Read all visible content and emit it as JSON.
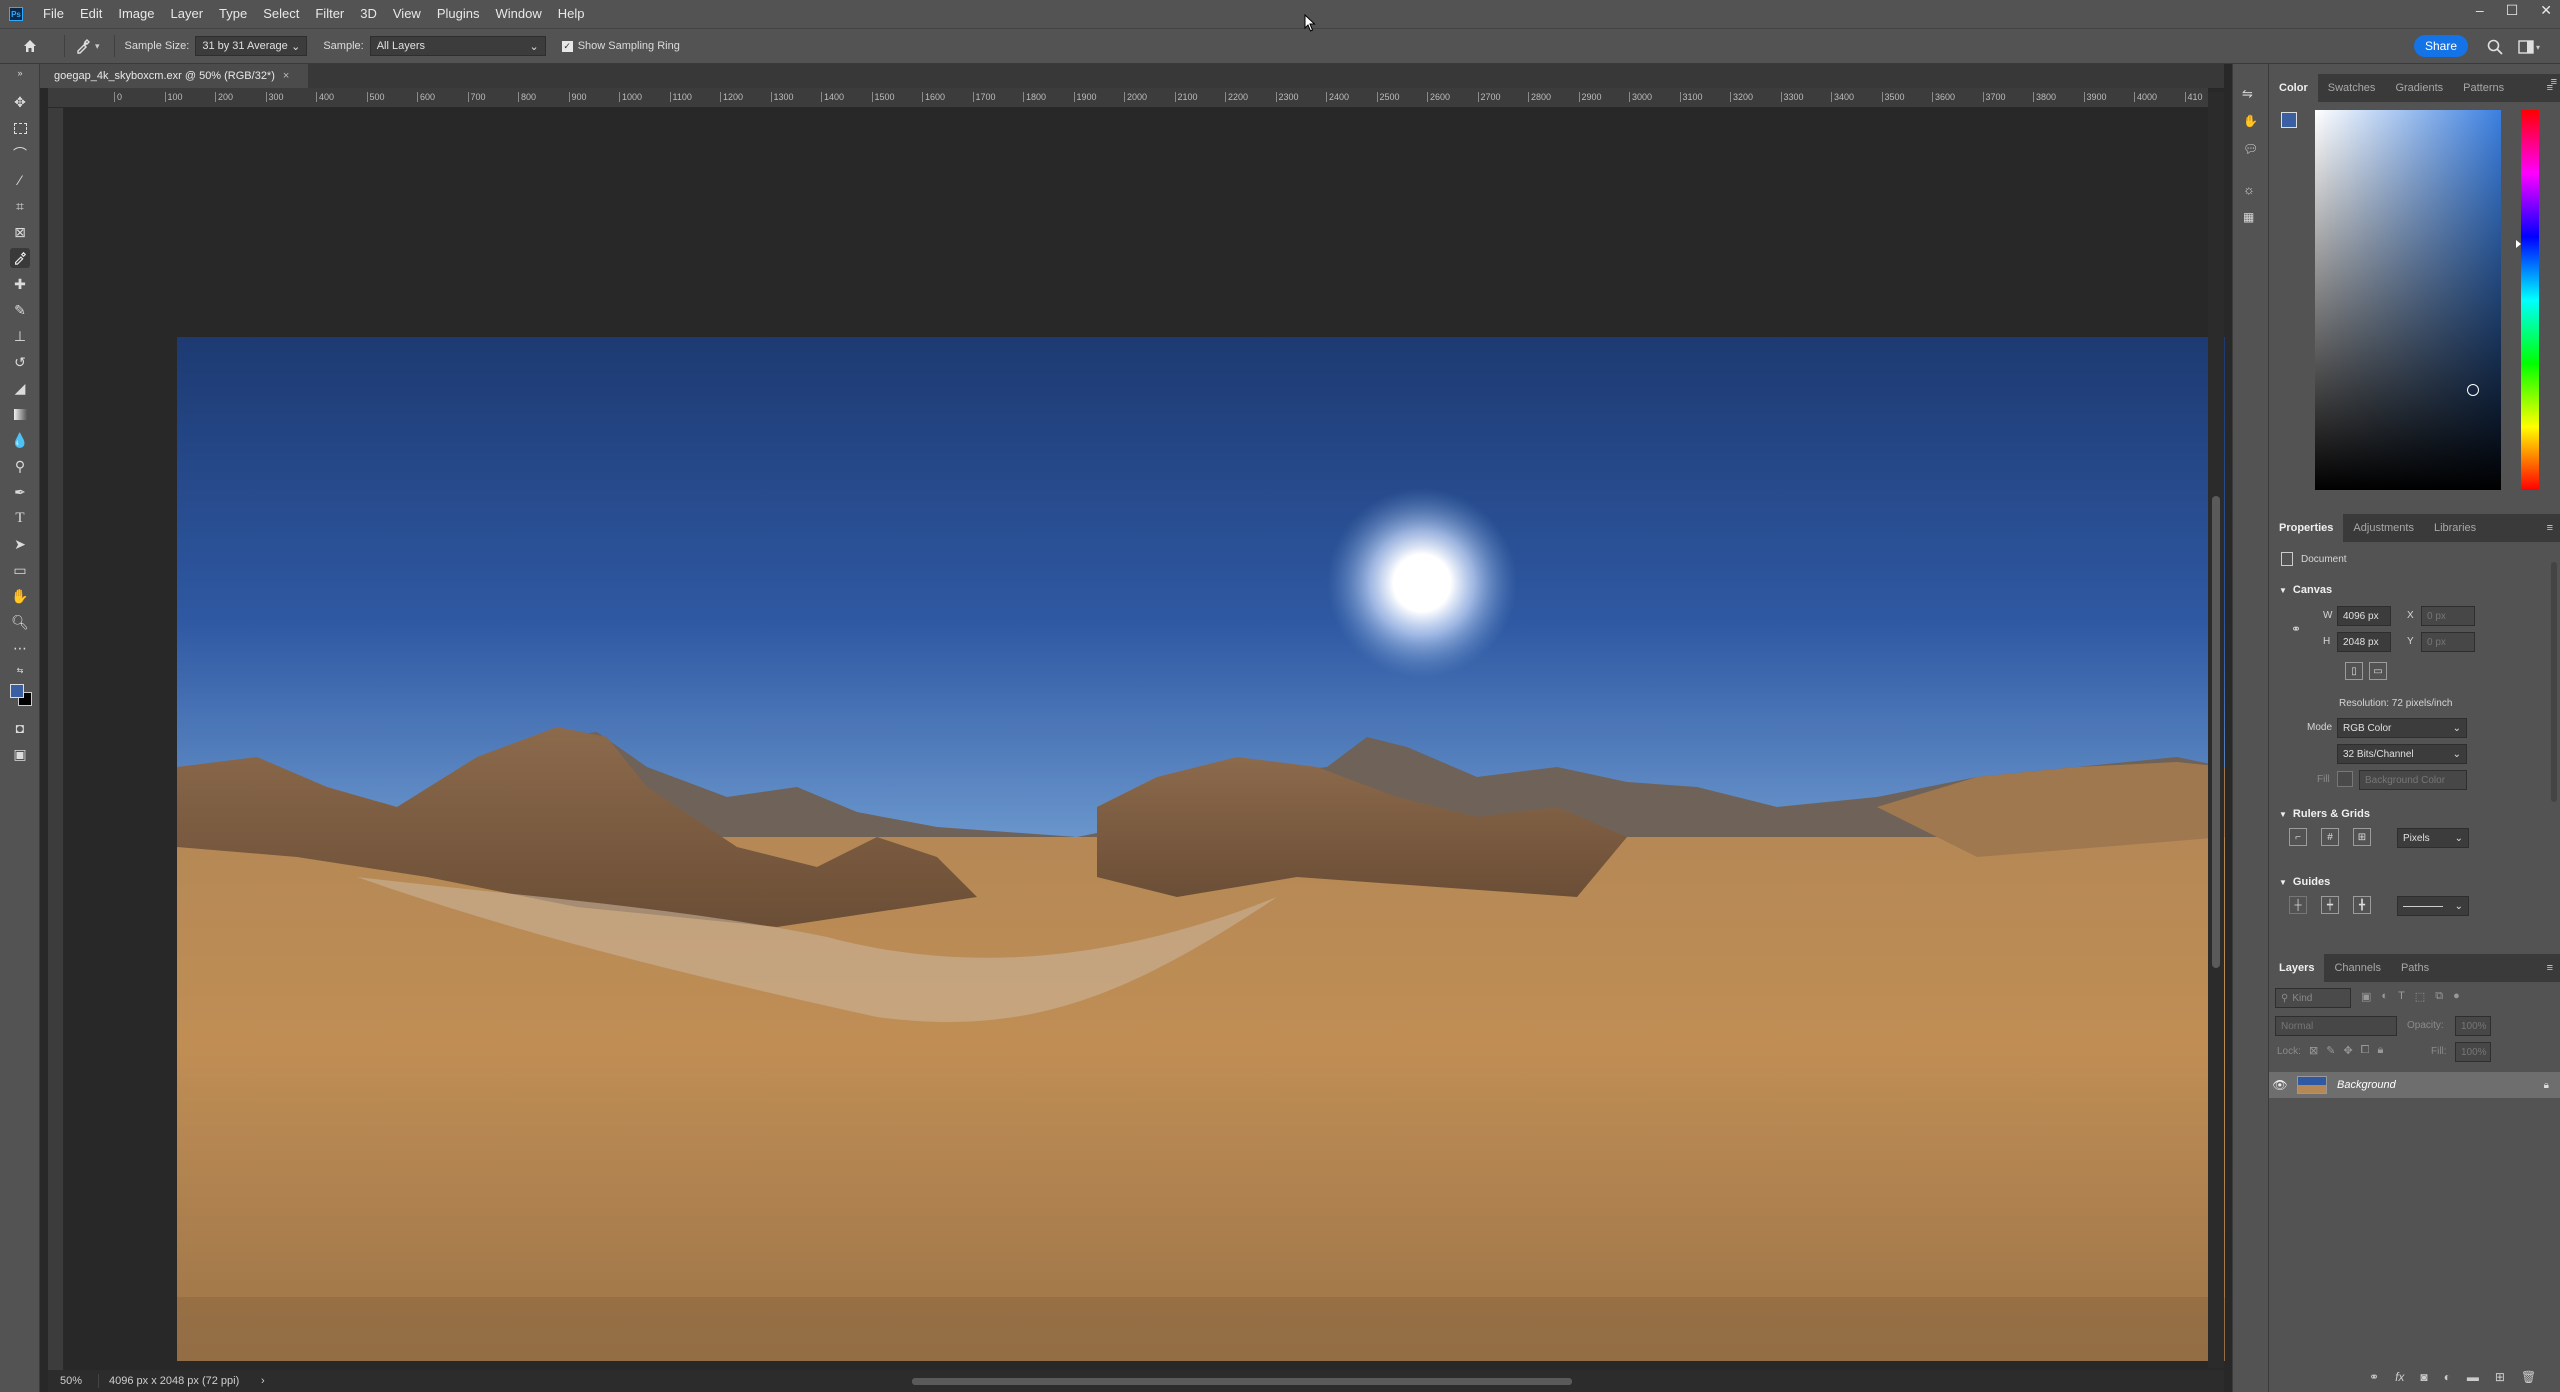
{
  "app": {
    "logo": "Ps"
  },
  "menu": [
    "File",
    "Edit",
    "Image",
    "Layer",
    "Type",
    "Select",
    "Filter",
    "3D",
    "View",
    "Plugins",
    "Window",
    "Help"
  ],
  "window_controls": {
    "minimize": "–",
    "maximize": "☐",
    "close": "✕"
  },
  "options": {
    "sample_size_label": "Sample Size:",
    "sample_size_value": "31 by 31 Average",
    "sample_label": "Sample:",
    "sample_value": "All Layers",
    "show_ring_label": "Show Sampling Ring",
    "show_ring_checked": true,
    "share_label": "Share"
  },
  "document": {
    "tab_title": "goegap_4k_skyboxcm.exr @ 50% (RGB/32*)",
    "close": "×"
  },
  "ruler_ticks": [
    "0",
    "100",
    "200",
    "300",
    "400",
    "500",
    "600",
    "700",
    "800",
    "900",
    "1000",
    "1100",
    "1200",
    "1300",
    "1400",
    "1500",
    "1600",
    "1700",
    "1800",
    "1900",
    "2000",
    "2100",
    "2200",
    "2300",
    "2400",
    "2500",
    "2600",
    "2700",
    "2800",
    "2900",
    "3000",
    "3100",
    "3200",
    "3300",
    "3400",
    "3500",
    "3600",
    "3700",
    "3800",
    "3900",
    "4000",
    "410"
  ],
  "status": {
    "zoom": "50%",
    "doc_info": "4096 px x 2048 px (72 ppi)",
    "arrow": "›"
  },
  "color_panel": {
    "tabs": [
      "Color",
      "Swatches",
      "Gradients",
      "Patterns"
    ],
    "active_tab": "Color",
    "foreground": "#3b5fa3",
    "background": "#000000"
  },
  "properties": {
    "tabs": [
      "Properties",
      "Adjustments",
      "Libraries"
    ],
    "active_tab": "Properties",
    "doc_label": "Document",
    "canvas_head": "Canvas",
    "w_label": "W",
    "w_value": "4096 px",
    "h_label": "H",
    "h_value": "2048 px",
    "x_label": "X",
    "x_value": "0 px",
    "y_label": "Y",
    "y_value": "0 px",
    "resolution": "Resolution: 72 pixels/inch",
    "mode_label": "Mode",
    "mode_value": "RGB Color",
    "bits_value": "32 Bits/Channel",
    "fill_label": "Fill",
    "fill_value": "Background Color",
    "rulers_head": "Rulers & Grids",
    "units_value": "Pixels",
    "guides_head": "Guides"
  },
  "layers": {
    "tabs": [
      "Layers",
      "Channels",
      "Paths"
    ],
    "active_tab": "Layers",
    "kind_placeholder": "Kind",
    "blend_mode": "Normal",
    "opacity_label": "Opacity:",
    "opacity_value": "100%",
    "lock_label": "Lock:",
    "fill_label": "Fill:",
    "fill_value": "100%",
    "items": [
      {
        "name": "Background",
        "visible": true,
        "locked": true
      }
    ]
  }
}
